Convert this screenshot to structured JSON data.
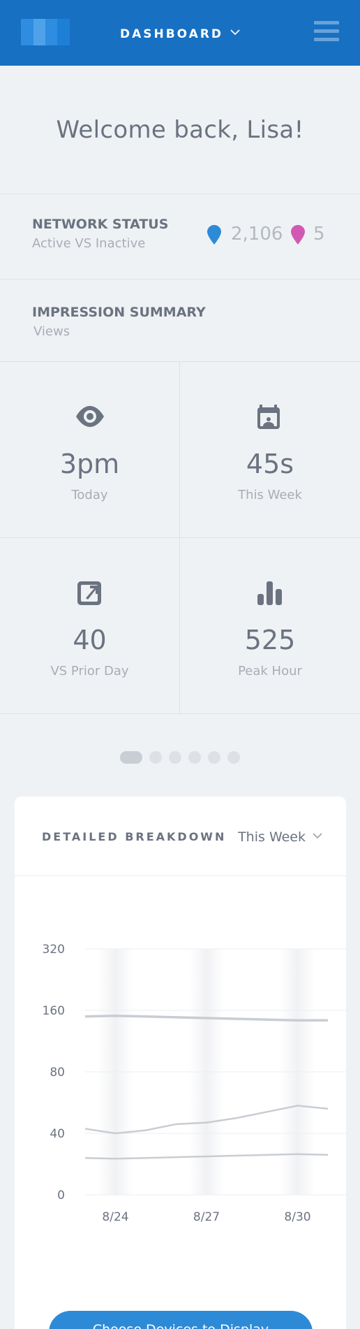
{
  "header": {
    "title": "DASHBOARD",
    "accent_color": "#1770c2",
    "logo": "logo-mark",
    "menu_icon": "hamburger-menu-icon",
    "dropdown_icon": "chevron-down-icon"
  },
  "welcome": {
    "text": "Welcome back, Lisa!"
  },
  "network_status": {
    "title": "NETWORK STATUS",
    "subtitle": "Active VS Inactive",
    "active": {
      "icon": "location-pin-icon",
      "color": "#2d8ad6",
      "value": "2,106"
    },
    "inactive": {
      "icon": "location-pin-icon",
      "color": "#d05ab3",
      "value": "5"
    }
  },
  "impression": {
    "title": "IMPRESSION SUMMARY",
    "subtitle": "Views"
  },
  "tiles": [
    {
      "icon": "eye-icon",
      "value": "3pm",
      "label": "Today"
    },
    {
      "icon": "calendar-icon",
      "value": "45s",
      "label": "This Week"
    },
    {
      "icon": "external-link-icon",
      "value": "40",
      "label": "VS Prior Day"
    },
    {
      "icon": "bar-chart-icon",
      "value": "525",
      "label": "Peak Hour"
    }
  ],
  "pager": {
    "count": 6,
    "active_index": 0
  },
  "breakdown": {
    "title": "DETAILED BREAKDOWN",
    "period": "This Week",
    "button_label": "Choose Devices to Display"
  },
  "chart_data": {
    "type": "line",
    "x": [
      "8/23",
      "8/24",
      "8/25",
      "8/26",
      "8/27",
      "8/28",
      "8/29",
      "8/30",
      "8/31"
    ],
    "x_tick_labels": [
      "8/24",
      "8/27",
      "8/30"
    ],
    "y_ticks": [
      0,
      40,
      80,
      160,
      320
    ],
    "ylabel": "",
    "xlabel": "",
    "grid": true,
    "series": [
      {
        "values": [
          152,
          153,
          152,
          151,
          150,
          149,
          148,
          147,
          147
        ]
      },
      {
        "values": [
          43,
          40,
          42,
          46,
          47,
          50,
          54,
          58,
          56
        ]
      },
      {
        "values": [
          24,
          23.5,
          24,
          24.5,
          25,
          25.5,
          26,
          26.5,
          26
        ]
      }
    ],
    "line_color": "#c8cdd3"
  }
}
